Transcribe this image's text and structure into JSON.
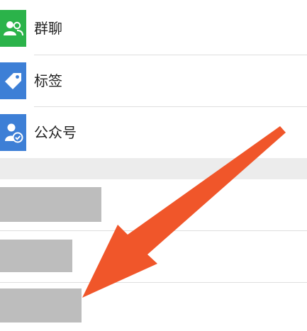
{
  "contacts_menu": {
    "items": [
      {
        "label": "群聊",
        "icon": "group-chat-icon",
        "color": "#2bb34a"
      },
      {
        "label": "标签",
        "icon": "tag-icon",
        "color": "#3d7fd6"
      },
      {
        "label": "公众号",
        "icon": "official-account-icon",
        "color": "#3d7fd6"
      }
    ]
  },
  "colors": {
    "section_gap": "#ececec",
    "redacted_block": "#bdbdbd",
    "annotation_arrow": "#f0562a"
  }
}
